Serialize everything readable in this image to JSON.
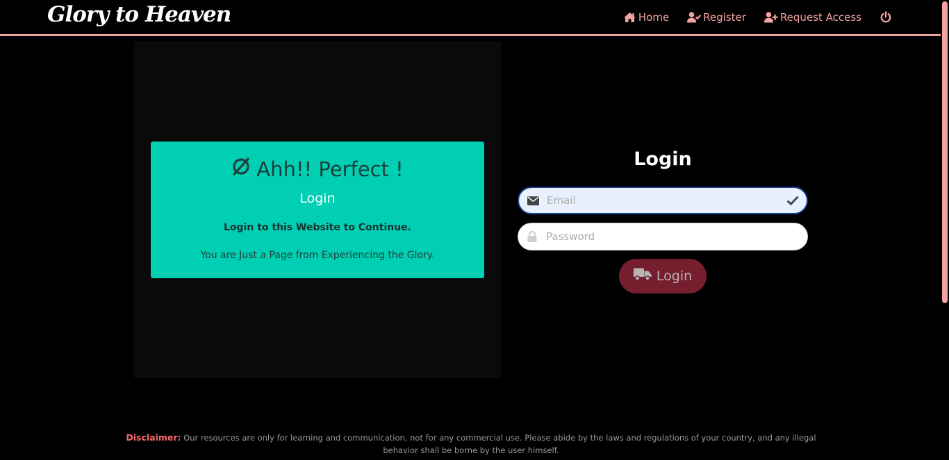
{
  "navbar": {
    "brand": "Glory to Heaven",
    "links": [
      {
        "label": "Home",
        "icon": "home-icon"
      },
      {
        "label": "Register",
        "icon": "user-check-icon"
      },
      {
        "label": "Request Access",
        "icon": "user-plus-icon"
      }
    ],
    "power_icon": "power-icon",
    "accent_color": "#f4a3a3"
  },
  "promo": {
    "icon": "refresh-circle-icon",
    "title": "Ahh!! Perfect !",
    "subtitle": "Login",
    "strong_text": "Login to this Website to Continue.",
    "text": "You are Just a Page from Experiencing the Glory.",
    "background_color": "#00cfb4"
  },
  "login": {
    "heading": "Login",
    "email": {
      "placeholder": "Email",
      "value": "",
      "icon": "envelope-icon",
      "status_icon": "check-icon"
    },
    "password": {
      "placeholder": "Password",
      "value": "",
      "icon": "lock-icon"
    },
    "button": {
      "label": "Login",
      "icon": "truck-icon",
      "color": "#761d2e"
    }
  },
  "footer": {
    "disclaimer_label": "Disclaimer:",
    "disclaimer_text": "Our resources are only for learning and communication, not for any commercial use. Please abide by the laws and regulations of your country, and any illegal behavior shall be borne by the user himself."
  }
}
